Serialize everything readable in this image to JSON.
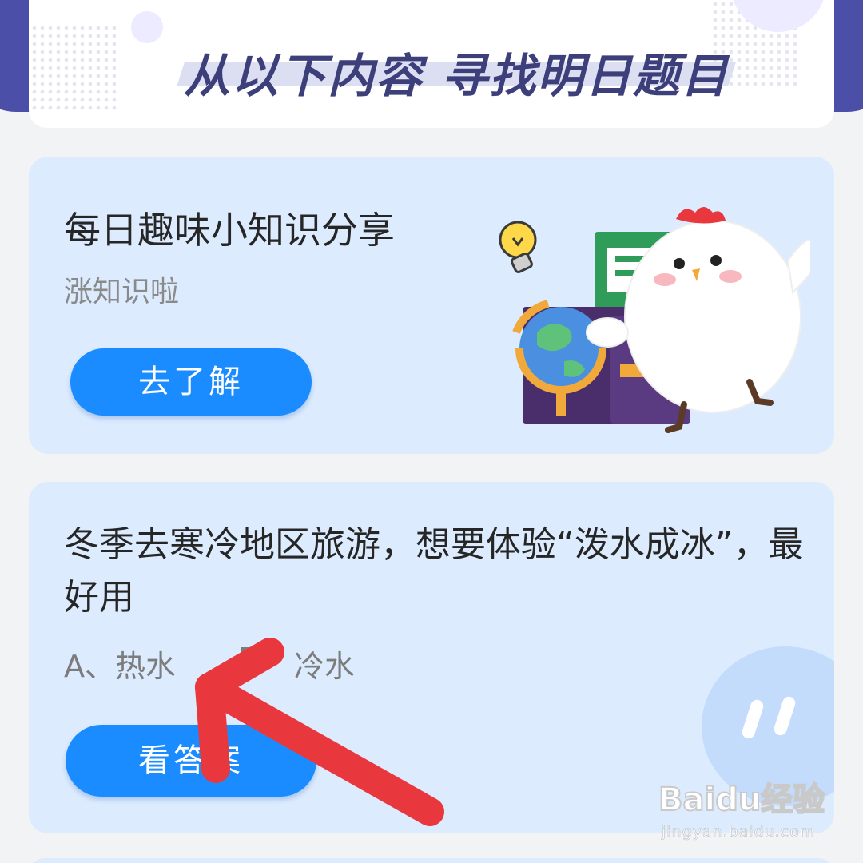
{
  "header": {
    "title": "从以下内容  寻找明日题目"
  },
  "knowledge_card": {
    "title": "每日趣味小知识分享",
    "subtitle": "涨知识啦",
    "button_label": "去了解"
  },
  "question_card": {
    "question": "冬季去寒冷地区旅游，想要体验“泼水成冰”，最好用",
    "option_a": "A、热水",
    "option_b_prefix": "B",
    "option_b": "冷水",
    "button_label": "看答案"
  },
  "watermark": {
    "brand": "Baidu经验",
    "url": "jingyan.baidu.com"
  },
  "colors": {
    "button_blue": "#1a8cff",
    "card_bg": "#dcebfd",
    "header_text": "#3d3f7a",
    "top_band": "#4b4fa8",
    "arrow_red": "#e8383d"
  },
  "icons": {
    "illustration": "chick-with-books-and-globe-illustration",
    "bubble": "chat-bubble-icon",
    "arrow": "red-pointer-arrow"
  }
}
